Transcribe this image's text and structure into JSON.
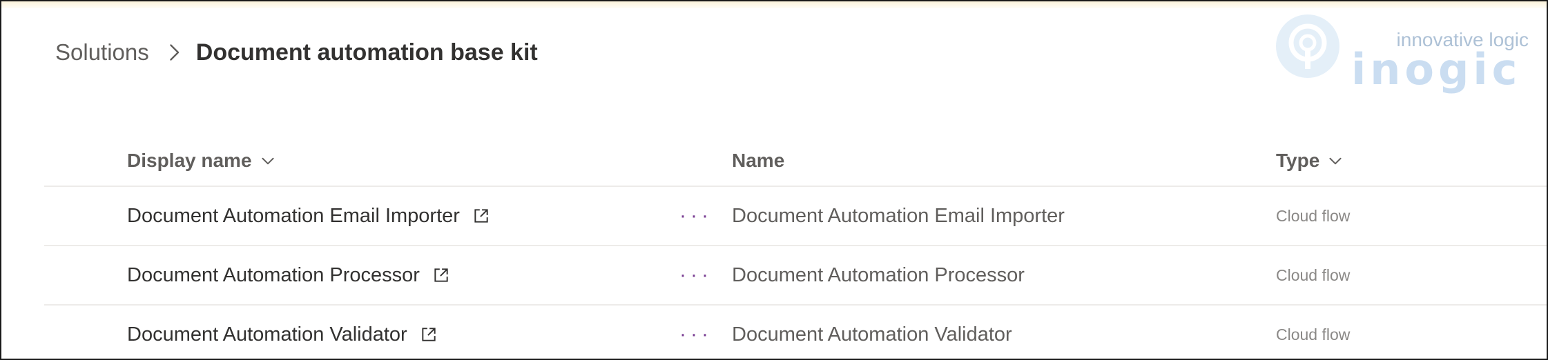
{
  "breadcrumb": {
    "root": "Solutions",
    "current": "Document automation base kit"
  },
  "logo": {
    "tagline": "innovative logic",
    "wordmark": "inogic"
  },
  "table": {
    "columns": {
      "display_name": "Display name",
      "name": "Name",
      "type": "Type"
    },
    "rows": [
      {
        "display_name": "Document Automation Email Importer",
        "name": "Document Automation Email Importer",
        "type": "Cloud flow",
        "more": "···"
      },
      {
        "display_name": "Document Automation Processor",
        "name": "Document Automation Processor",
        "type": "Cloud flow",
        "more": "···"
      },
      {
        "display_name": "Document Automation Validator",
        "name": "Document Automation Validator",
        "type": "Cloud flow",
        "more": "···"
      }
    ]
  },
  "colors": {
    "accent_more": "#7a3e93",
    "text_primary": "#323130",
    "text_secondary": "#605e5c"
  },
  "icons": [
    "chevron-right-icon",
    "chevron-down-icon",
    "open-external-icon",
    "more-options-icon"
  ]
}
